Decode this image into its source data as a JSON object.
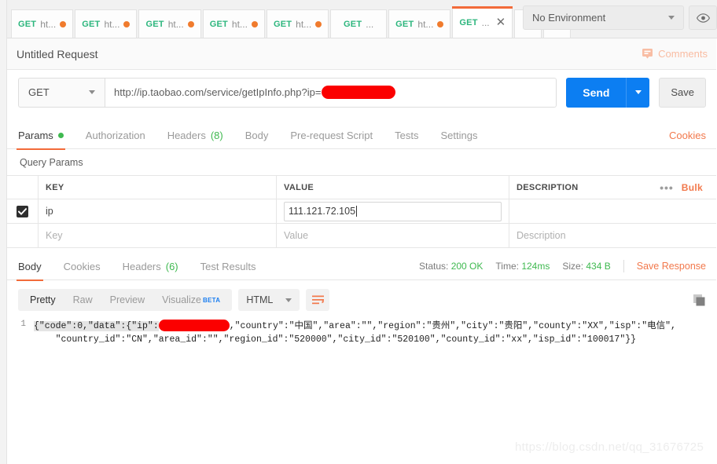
{
  "tabstrip": {
    "tabs": [
      {
        "method": "GET",
        "label": "ht...",
        "dot": true,
        "active": false
      },
      {
        "method": "GET",
        "label": "ht...",
        "dot": true,
        "active": false
      },
      {
        "method": "GET",
        "label": "ht...",
        "dot": true,
        "active": false
      },
      {
        "method": "GET",
        "label": "ht...",
        "dot": true,
        "active": false
      },
      {
        "method": "GET",
        "label": "ht...",
        "dot": true,
        "active": false
      },
      {
        "method": "GET",
        "label": "...",
        "dot": false,
        "active": false
      },
      {
        "method": "GET",
        "label": "ht...",
        "dot": true,
        "active": false
      },
      {
        "method": "GET",
        "label": "...",
        "dot": false,
        "active": true
      }
    ],
    "new_tab_label": "+",
    "more_label": "•••",
    "close_label": "✕",
    "environment": {
      "selected": "No Environment",
      "eye_icon": "eye-icon"
    }
  },
  "request": {
    "title": "Untitled Request",
    "comments_label": "Comments",
    "method": "GET",
    "url_prefix": "http://ip.taobao.com/service/getIpInfo.php?ip=",
    "url_redacted": true,
    "send_label": "Send",
    "save_label": "Save",
    "tabs": [
      {
        "label": "Params",
        "badge": "",
        "dot": true,
        "active": true
      },
      {
        "label": "Authorization",
        "badge": "",
        "dot": false,
        "active": false
      },
      {
        "label": "Headers",
        "badge": "(8)",
        "dot": false,
        "active": false
      },
      {
        "label": "Body",
        "badge": "",
        "dot": false,
        "active": false
      },
      {
        "label": "Pre-request Script",
        "badge": "",
        "dot": false,
        "active": false
      },
      {
        "label": "Tests",
        "badge": "",
        "dot": false,
        "active": false
      },
      {
        "label": "Settings",
        "badge": "",
        "dot": false,
        "active": false
      }
    ],
    "cookies_link": "Cookies"
  },
  "query_params": {
    "section_label": "Query Params",
    "headers": {
      "key": "KEY",
      "value": "VALUE",
      "description": "DESCRIPTION"
    },
    "bulk_label": "Bulk",
    "dots_label": "•••",
    "rows": [
      {
        "checked": true,
        "key": "ip",
        "value": "111.121.72.105",
        "description": ""
      }
    ],
    "placeholders": {
      "key": "Key",
      "value": "Value",
      "description": "Description"
    }
  },
  "response": {
    "tabs": [
      {
        "label": "Body",
        "badge": "",
        "active": true
      },
      {
        "label": "Cookies",
        "badge": "",
        "active": false
      },
      {
        "label": "Headers",
        "badge": "(6)",
        "active": false
      },
      {
        "label": "Test Results",
        "badge": "",
        "active": false
      }
    ],
    "status_label": "Status:",
    "status_value": "200 OK",
    "time_label": "Time:",
    "time_value": "124ms",
    "size_label": "Size:",
    "size_value": "434 B",
    "save_response_label": "Save Response",
    "view_modes": [
      {
        "label": "Pretty",
        "active": true,
        "beta": ""
      },
      {
        "label": "Raw",
        "active": false,
        "beta": ""
      },
      {
        "label": "Preview",
        "active": false,
        "beta": ""
      },
      {
        "label": "Visualize",
        "active": false,
        "beta": "BETA"
      }
    ],
    "format": "HTML",
    "wrap_icon": "wrap-lines-icon",
    "copy_icon": "copy-icon",
    "body": {
      "line_number": "1",
      "part1": "{\"code\":0,\"data\":{\"ip\":",
      "part2": ",\"country\":\"中国\",\"area\":\"\",\"region\":\"贵州\",\"city\":\"贵阳\",\"county\":\"XX\",\"isp\":\"电信\",\n    \"country_id\":\"CN\",\"area_id\":\"\",\"region_id\":\"520000\",\"city_id\":\"520100\",\"county_id\":\"xx\",\"isp_id\":\"100017\"}}"
    }
  },
  "watermark": "https://blog.csdn.net/qq_31676725",
  "colors": {
    "accent_orange": "#f26b3a",
    "send_blue": "#0c7ef2",
    "method_green": "#2cb67d",
    "status_green": "#3fb950",
    "redaction_red": "#fb0000"
  }
}
